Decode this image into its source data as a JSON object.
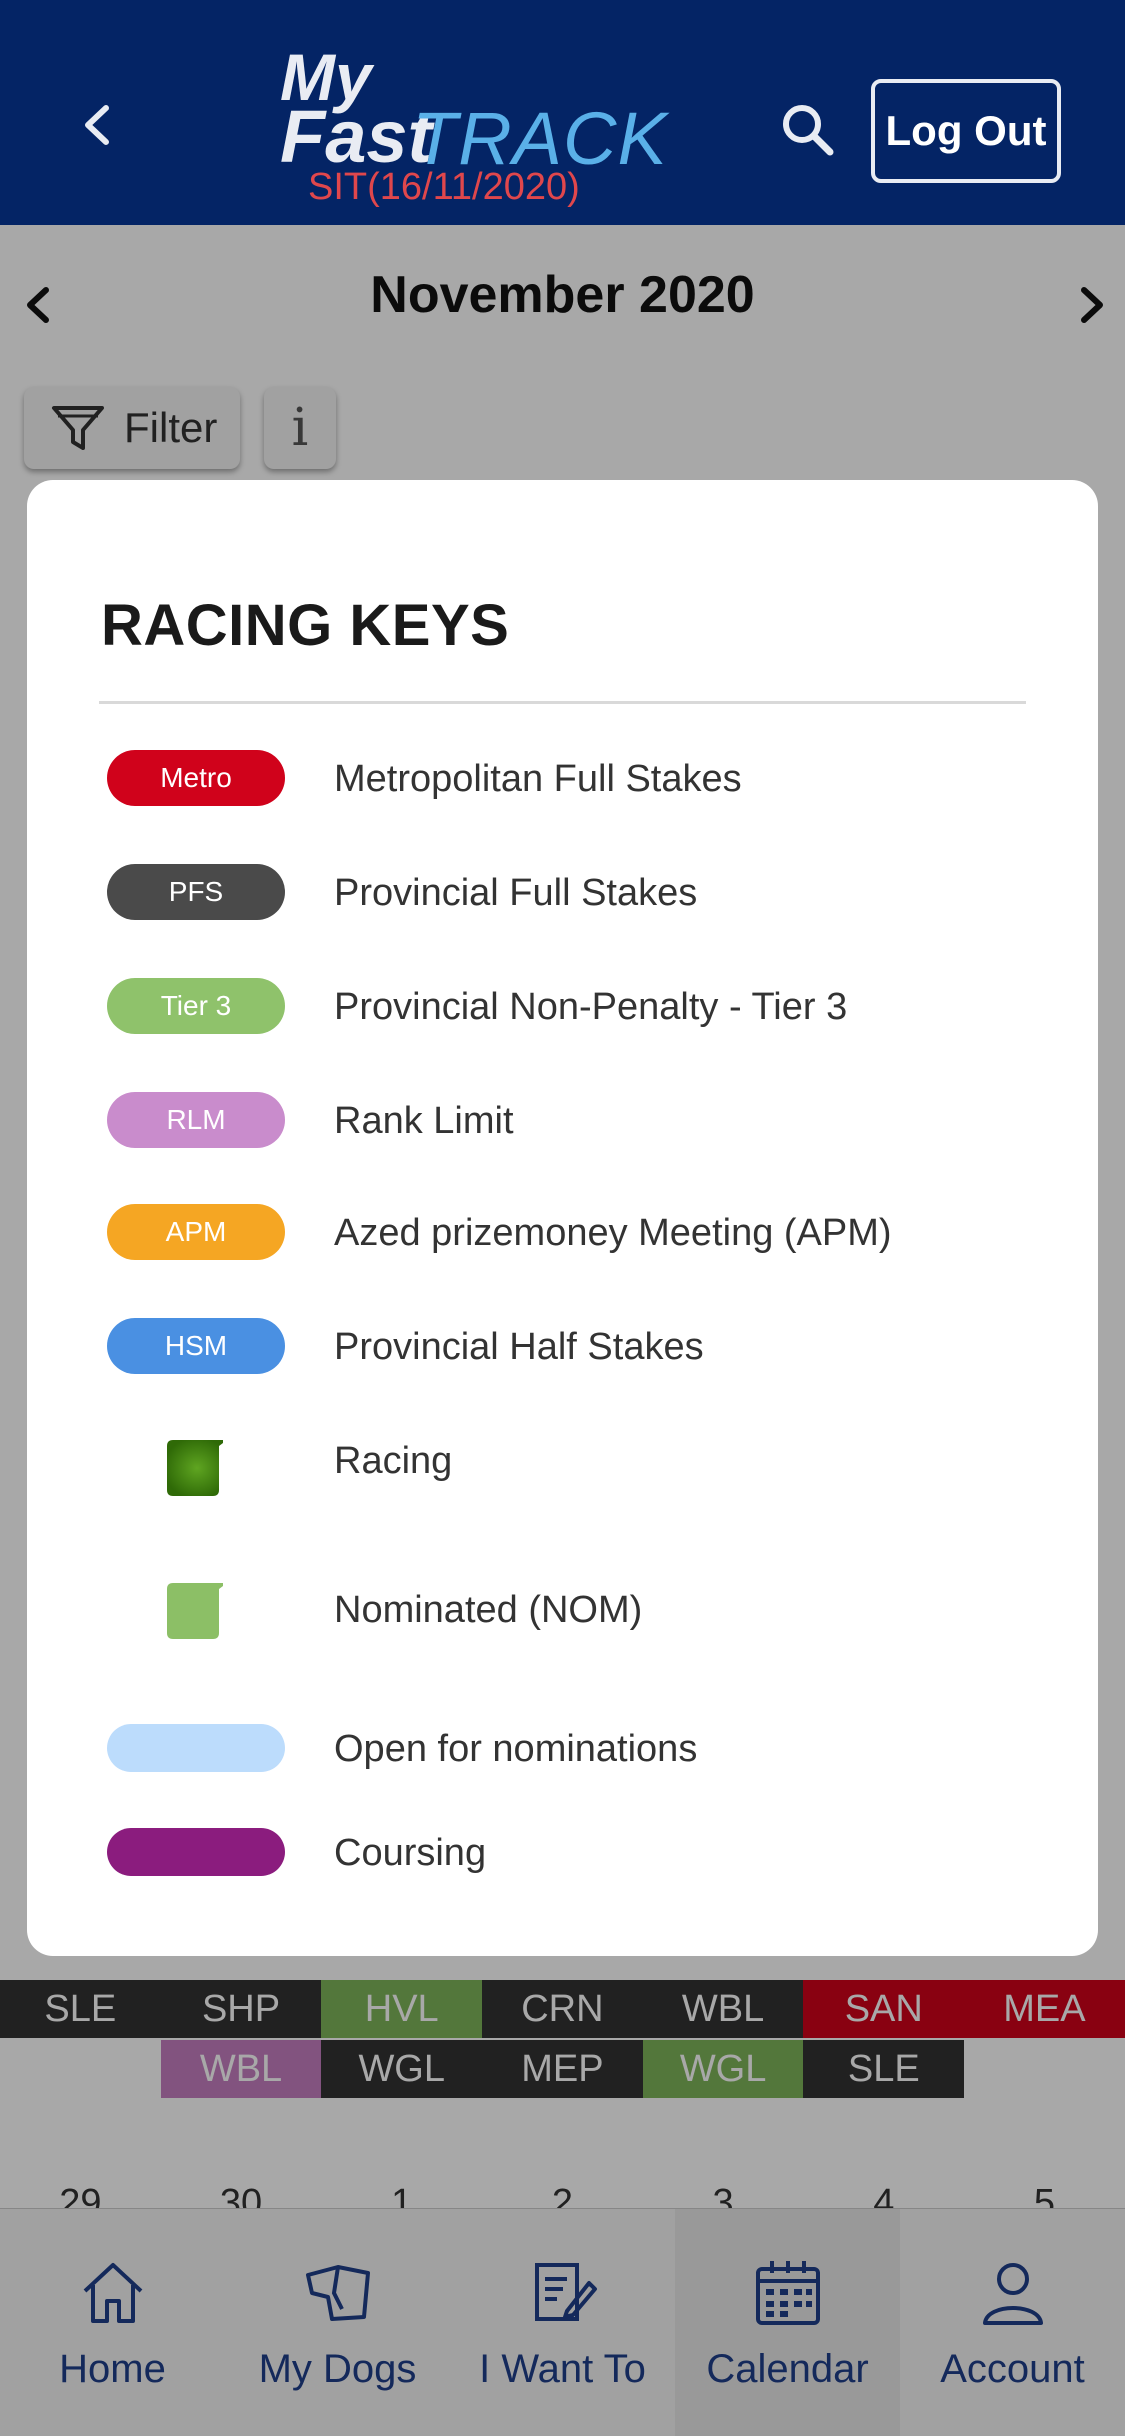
{
  "header": {
    "logo_my": "My",
    "logo_fast": "Fast",
    "logo_track": "TRACK",
    "logo_sub": "SIT(16/11/2020)",
    "logout_label": "Log Out",
    "background": "#042465"
  },
  "calendar": {
    "month": "November 2020",
    "filter_label": "Filter",
    "info_label": "i",
    "rows": [
      {
        "cells": [
          {
            "t": "SLE",
            "c": "#333333"
          },
          {
            "t": "SHP",
            "c": "#333333"
          },
          {
            "t": "HVL",
            "c": "#7fb55a"
          },
          {
            "t": "CRN",
            "c": "#333333"
          },
          {
            "t": "WBL",
            "c": "#333333"
          },
          {
            "t": "SAN",
            "c": "#d0021b"
          },
          {
            "t": "MEA",
            "c": "#d0021b"
          }
        ]
      },
      {
        "cells": [
          {
            "t": "",
            "c": "transparent"
          },
          {
            "t": "WBL",
            "c": "#c57fc1"
          },
          {
            "t": "WGL",
            "c": "#333333"
          },
          {
            "t": "MEP",
            "c": "#333333"
          },
          {
            "t": "WGL",
            "c": "#7fb55a"
          },
          {
            "t": "SLE",
            "c": "#333333"
          },
          {
            "t": "",
            "c": "transparent"
          }
        ]
      }
    ],
    "dates": [
      "29",
      "30",
      "1",
      "2",
      "3",
      "4",
      "5"
    ]
  },
  "modal": {
    "title": "RACING KEYS",
    "keys": [
      {
        "badge": "Metro",
        "label": "Metropolitan Full Stakes",
        "color": "#d0021b",
        "type": "pill"
      },
      {
        "badge": "PFS",
        "label": "Provincial Full Stakes",
        "color": "#4a4a4a",
        "type": "pill"
      },
      {
        "badge": "Tier 3",
        "label": "Provincial Non-Penalty - Tier 3",
        "color": "#8fc26b",
        "type": "pill"
      },
      {
        "badge": "RLM",
        "label": "Rank Limit",
        "color": "#c98ccc",
        "type": "pill"
      },
      {
        "badge": "APM",
        "label": "Azed prizemoney Meeting (APM)",
        "color": "#f5a623",
        "type": "pill"
      },
      {
        "badge": "HSM",
        "label": "Provincial Half Stakes",
        "color": "#4a90e2",
        "type": "pill"
      },
      {
        "badge": "",
        "label": "Racing",
        "color": "#3e7d0b",
        "type": "square"
      },
      {
        "badge": "",
        "label": "Nominated (NOM)",
        "color": "#8cbf66",
        "type": "square"
      },
      {
        "badge": "",
        "label": "Open for nominations",
        "color": "#bcdcfc",
        "type": "thin"
      },
      {
        "badge": "",
        "label": "Coursing",
        "color": "#8b1c7e",
        "type": "thin"
      }
    ]
  },
  "nav": {
    "items": [
      {
        "label": "Home",
        "icon": "home-icon"
      },
      {
        "label": "My Dogs",
        "icon": "dog-icon"
      },
      {
        "label": "I Want To",
        "icon": "edit-icon"
      },
      {
        "label": "Calendar",
        "icon": "calendar-icon"
      },
      {
        "label": "Account",
        "icon": "account-icon"
      }
    ],
    "active": "Calendar",
    "accent": "#1f3f8a"
  }
}
